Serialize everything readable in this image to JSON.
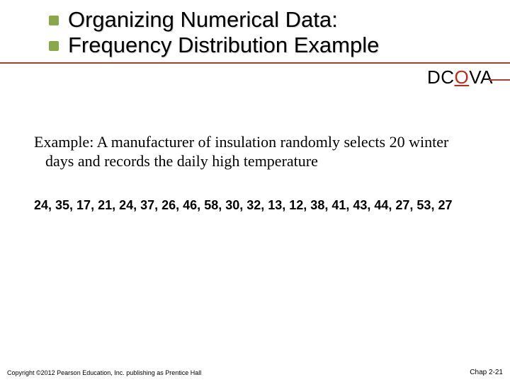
{
  "title": {
    "line1": "Organizing Numerical Data:",
    "line2": "Frequency Distribution Example"
  },
  "dcova": {
    "d": "D",
    "c": "C",
    "o": "O",
    "v": "V",
    "a": "A"
  },
  "example_text": "Example: A manufacturer of insulation randomly selects 20 winter days and records the daily high temperature",
  "data_values": "24, 35, 17, 21, 24, 37, 26, 46, 58, 30, 32, 13, 12, 38, 41, 43, 44, 27, 53, 27",
  "footer": {
    "copyright": "Copyright ©2012 Pearson Education, Inc. publishing as Prentice Hall",
    "chapter": "Chap 2-21"
  }
}
